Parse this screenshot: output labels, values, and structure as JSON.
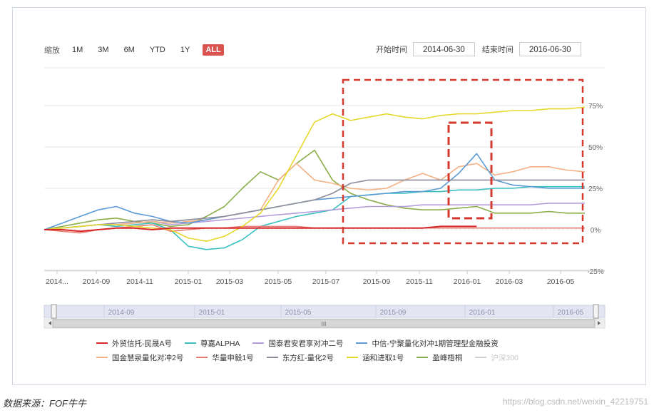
{
  "toolbar": {
    "zoom_label": "缩放",
    "ranges": [
      "1M",
      "3M",
      "6M",
      "YTD",
      "1Y",
      "ALL"
    ],
    "active_range": "ALL",
    "start_label": "开始时间",
    "start_value": "2014-06-30",
    "end_label": "结束时间",
    "end_value": "2016-06-30"
  },
  "navigator": {
    "ticks": [
      "2014-09",
      "2015-01",
      "2015-05",
      "2015-09",
      "2016-01",
      "2016-05"
    ],
    "handle_text": "III"
  },
  "caption": "数据来源：FOF牛牛",
  "watermark": "https://blog.csdn.net/weixin_42219751",
  "colors": {
    "highlight_box": "#d63a2f",
    "grid": "#e6e6e6",
    "navigator_bg": "#e3e6f2"
  },
  "chart_data": {
    "type": "line",
    "x_ticks": [
      "2014...",
      "2014-09",
      "2014-11",
      "2015-01",
      "2015-03",
      "2015-05",
      "2015-07",
      "2015-09",
      "2015-11",
      "2016-01",
      "2016-03",
      "2016-05"
    ],
    "y_ticks": [
      "75%",
      "50%",
      "25%",
      "0%",
      "-25%"
    ],
    "ylim": [
      -25,
      75
    ],
    "legend_position": "bottom",
    "series": [
      {
        "name": "外贸信托-民晟A号",
        "color": "#d62728",
        "values": [
          0,
          0,
          -1,
          0,
          1,
          1,
          0,
          1,
          1,
          1,
          1,
          1,
          1,
          1,
          1,
          1,
          1,
          1,
          1,
          1,
          1,
          1,
          2,
          2,
          2,
          null,
          null,
          null,
          null,
          null,
          null
        ]
      },
      {
        "name": "尊嘉ALPHA",
        "color": "#3cbfbf",
        "values": [
          0,
          1,
          2,
          3,
          2,
          3,
          4,
          0,
          -10,
          -12,
          -11,
          -6,
          2,
          5,
          8,
          10,
          12,
          20,
          21,
          22,
          22,
          23,
          23,
          24,
          24,
          25,
          25,
          26,
          26,
          26,
          26
        ]
      },
      {
        "name": "国泰君安君享对冲二号",
        "color": "#b39ddb",
        "values": [
          0,
          1,
          2,
          3,
          3,
          4,
          5,
          3,
          4,
          5,
          6,
          7,
          8,
          9,
          10,
          11,
          12,
          13,
          14,
          14,
          14,
          15,
          15,
          15,
          15,
          15,
          15,
          15,
          16,
          16,
          16
        ]
      },
      {
        "name": "中信-宁聚量化对冲1期管理型金融投资",
        "color": "#5b9bd5",
        "values": [
          0,
          4,
          8,
          12,
          14,
          10,
          8,
          5,
          4,
          6,
          8,
          10,
          12,
          14,
          16,
          18,
          19,
          20,
          21,
          22,
          23,
          23,
          25,
          34,
          46,
          30,
          27,
          26,
          25,
          25,
          25
        ]
      },
      {
        "name": "国金慧泉量化对冲2号",
        "color": "#f4b183",
        "values": [
          0,
          1,
          2,
          3,
          3,
          4,
          5,
          4,
          5,
          6,
          8,
          10,
          12,
          30,
          40,
          30,
          28,
          25,
          24,
          25,
          30,
          34,
          30,
          38,
          40,
          33,
          35,
          38,
          38,
          36,
          35
        ]
      },
      {
        "name": "华量申毅1号",
        "color": "#e67c73",
        "values": [
          0,
          -1,
          -2,
          0,
          1,
          2,
          3,
          -1,
          0,
          1,
          1,
          2,
          2,
          2,
          2,
          1,
          1,
          1,
          1,
          1,
          1,
          1,
          1,
          1,
          1,
          1,
          1,
          1,
          1,
          1,
          1
        ]
      },
      {
        "name": "东方红-量化2号",
        "color": "#8c8c9a",
        "values": [
          0,
          1,
          2,
          3,
          4,
          5,
          6,
          5,
          6,
          7,
          8,
          10,
          12,
          14,
          16,
          18,
          22,
          28,
          30,
          30,
          30,
          30,
          30,
          30,
          30,
          30,
          30,
          30,
          30,
          30,
          30
        ]
      },
      {
        "name": "涵和进取1号",
        "color": "#e6d82c",
        "values": [
          0,
          1,
          2,
          3,
          3,
          2,
          1,
          0,
          -5,
          -7,
          -4,
          2,
          10,
          25,
          45,
          65,
          70,
          66,
          68,
          70,
          68,
          67,
          69,
          70,
          70,
          71,
          72,
          72,
          73,
          73,
          74
        ]
      },
      {
        "name": "盈峰梧桐",
        "color": "#8bad4a",
        "values": [
          0,
          2,
          4,
          6,
          7,
          5,
          4,
          2,
          3,
          8,
          14,
          25,
          35,
          30,
          40,
          48,
          30,
          22,
          18,
          15,
          13,
          12,
          12,
          13,
          14,
          10,
          10,
          10,
          11,
          10,
          10
        ]
      },
      {
        "name": "沪深300",
        "color": "#d0d0d0",
        "values": []
      }
    ]
  }
}
